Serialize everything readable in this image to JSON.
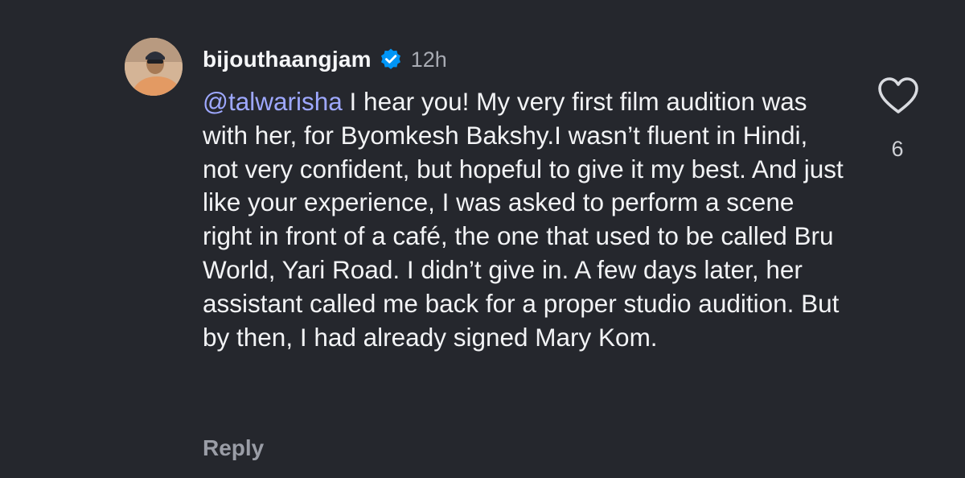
{
  "comment": {
    "username": "bijouthaangjam",
    "verified": true,
    "timestamp": "12h",
    "mention": "@talwarisha",
    "text": " I hear you! My very first film audition was with her, for Byomkesh Bakshy.I wasn’t fluent in Hindi, not very confident, but hopeful to give it my best. And just like your experience, I was asked to perform a scene right in front of a café, the one that used to be called Bru World, Yari Road. I didn’t give in. A few days later, her assistant called me back for a proper studio audition. But by then, I had already signed Mary Kom.",
    "reply_label": "Reply",
    "like_count": "6",
    "icons": {
      "verified": "verified-badge-icon",
      "like": "heart-outline-icon"
    }
  },
  "colors": {
    "background": "#25272d",
    "text": "#f2f3f5",
    "mention": "#9ea8ff",
    "muted": "#a8abb3",
    "verified": "#0095f6"
  }
}
